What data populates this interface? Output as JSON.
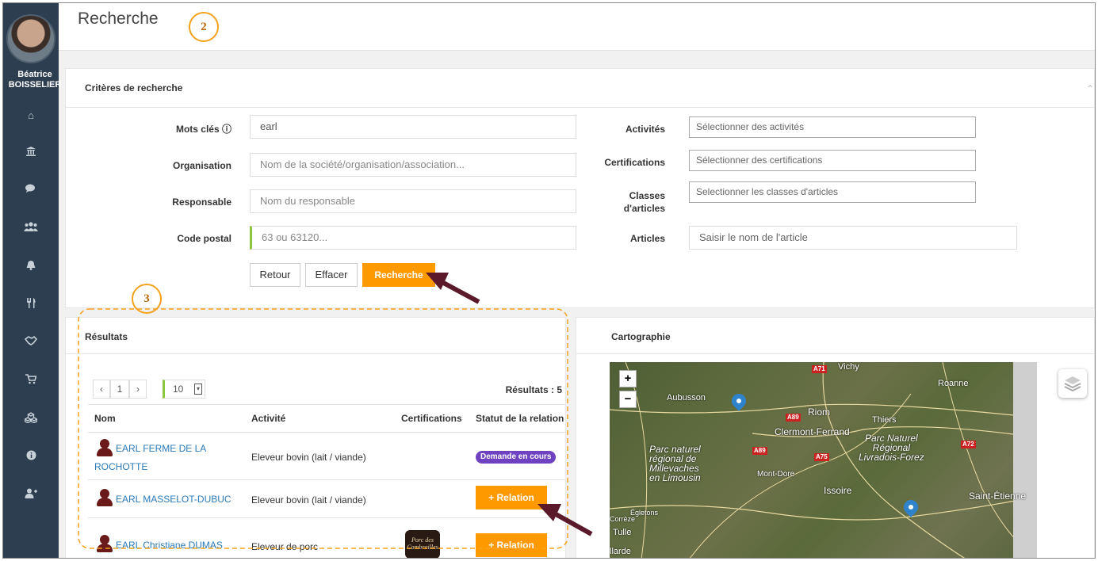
{
  "user": {
    "first_name": "Béatrice",
    "last_name": "BOISSELIER"
  },
  "sidebar": {
    "icons": [
      "home-icon",
      "bank-icon",
      "comments-icon",
      "users-icon",
      "bell-icon",
      "cutlery-icon",
      "handshake-icon",
      "cart-icon",
      "cubes-icon",
      "info-icon",
      "user-plus-icon"
    ],
    "glyphs": [
      "⌂",
      "⌂",
      "●",
      "●",
      "▲",
      "♈",
      "☀",
      "▾",
      "✿",
      "ℹ",
      "♟"
    ]
  },
  "page": {
    "title": "Recherche"
  },
  "annotations": {
    "step2": "2",
    "step3": "3"
  },
  "criteria": {
    "title": "Critères de recherche",
    "keywords_label": "Mots clés ⓘ",
    "keywords_value": "earl",
    "organisation_label": "Organisation",
    "organisation_placeholder": "Nom de la société/organisation/association...",
    "responsable_label": "Responsable",
    "responsable_placeholder": "Nom du responsable",
    "postal_label": "Code postal",
    "postal_placeholder": "63 ou 63120...",
    "activites_label": "Activités",
    "activites_placeholder": "Sélectionner des activités",
    "certifications_label": "Certifications",
    "certifications_placeholder": "Sélectionner des certifications",
    "classes_label_1": "Classes",
    "classes_label_2": "d'articles",
    "classes_placeholder": "Selectionner les classes d'articles",
    "articles_label": "Articles",
    "articles_placeholder": "Saisir le nom de l'article",
    "btn_retour": "Retour",
    "btn_effacer": "Effacer",
    "btn_recherche": "Recherche"
  },
  "results": {
    "title": "Résultats",
    "pager_prev": "‹",
    "pager_page": "1",
    "pager_next": "›",
    "page_size": "10",
    "count_label": "Résultats : 5",
    "columns": [
      "Nom",
      "Activité",
      "Certifications",
      "Statut de la relation"
    ],
    "rows": [
      {
        "name_1": "EARL FERME DE LA",
        "name_2": "ROCHOTTE",
        "activity": "Eleveur bovin (lait / viande)",
        "status": "Demande en cours"
      },
      {
        "name_1": "EARL MASSELOT-DUBUC",
        "activity": "Eleveur bovin (lait / viande)",
        "status": "+ Relation"
      },
      {
        "name_1": "EARL Christiane DUMAS",
        "activity": "Eleveur de porc",
        "cert_logo_1": "Porc des",
        "cert_logo_2": "Combrailles",
        "status": "+ Relation"
      }
    ]
  },
  "map": {
    "title": "Cartographie",
    "zoom_in": "+",
    "zoom_out": "−",
    "places": [
      "Vichy",
      "Roanne",
      "Aubusson",
      "Riom",
      "Thiers",
      "Clermont-Ferrand",
      "Mont-Dore",
      "Issoire",
      "Saint-Étienne",
      "Égletons",
      "Corrèze",
      "Tulle",
      "llarde"
    ],
    "parks": [
      [
        "Parc naturel",
        "régional de",
        "Millevaches",
        "en Limousin"
      ],
      [
        "Parc Naturel",
        "Régional",
        "Livradois-Forez"
      ]
    ],
    "roads": [
      "A71",
      "A89",
      "A89",
      "A75",
      "A72"
    ]
  },
  "colors": {
    "sidebar": "#2c3e50",
    "accent": "#ff9900",
    "badge": "#6f42c1",
    "link": "#2a7ab8",
    "annotation": "#f5a11c",
    "arrow": "#5a1a2a",
    "pin": "#2f83cc"
  }
}
